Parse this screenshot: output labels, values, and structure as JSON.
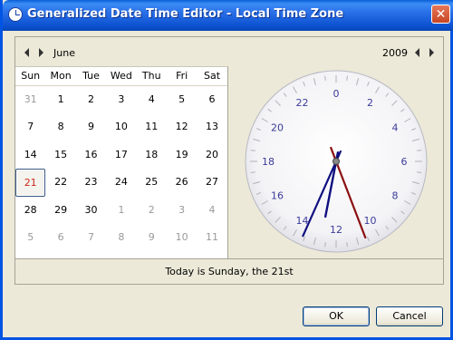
{
  "window": {
    "title": "Generalized Date Time Editor - Local Time Zone",
    "close_label": "✕"
  },
  "navigator": {
    "month": "June",
    "year": "2009"
  },
  "calendar": {
    "weekdays": [
      "Sun",
      "Mon",
      "Tue",
      "Wed",
      "Thu",
      "Fri",
      "Sat"
    ],
    "weeks": [
      [
        {
          "d": "31",
          "o": true
        },
        {
          "d": "1"
        },
        {
          "d": "2"
        },
        {
          "d": "3"
        },
        {
          "d": "4"
        },
        {
          "d": "5"
        },
        {
          "d": "6"
        }
      ],
      [
        {
          "d": "7"
        },
        {
          "d": "8"
        },
        {
          "d": "9"
        },
        {
          "d": "10"
        },
        {
          "d": "11"
        },
        {
          "d": "12"
        },
        {
          "d": "13"
        }
      ],
      [
        {
          "d": "14"
        },
        {
          "d": "15"
        },
        {
          "d": "16"
        },
        {
          "d": "17"
        },
        {
          "d": "18"
        },
        {
          "d": "19"
        },
        {
          "d": "20"
        }
      ],
      [
        {
          "d": "21",
          "today": true
        },
        {
          "d": "22"
        },
        {
          "d": "23"
        },
        {
          "d": "24"
        },
        {
          "d": "25"
        },
        {
          "d": "26"
        },
        {
          "d": "27"
        }
      ],
      [
        {
          "d": "28"
        },
        {
          "d": "29"
        },
        {
          "d": "30"
        },
        {
          "d": "1",
          "o": true
        },
        {
          "d": "2",
          "o": true
        },
        {
          "d": "3",
          "o": true
        },
        {
          "d": "4",
          "o": true
        }
      ],
      [
        {
          "d": "5",
          "o": true
        },
        {
          "d": "6",
          "o": true
        },
        {
          "d": "7",
          "o": true
        },
        {
          "d": "8",
          "o": true
        },
        {
          "d": "9",
          "o": true
        },
        {
          "d": "10",
          "o": true
        },
        {
          "d": "11",
          "o": true
        }
      ]
    ]
  },
  "clock": {
    "hour_labels": [
      "0",
      "2",
      "4",
      "6",
      "8",
      "10",
      "12",
      "14",
      "16",
      "18",
      "20",
      "22"
    ],
    "label_color": "#3b3b9a",
    "hand_color_blue": "#101080",
    "hand_color_red": "#8b1010"
  },
  "status": {
    "text": "Today is Sunday, the 21st"
  },
  "buttons": {
    "ok": "OK",
    "cancel": "Cancel"
  }
}
